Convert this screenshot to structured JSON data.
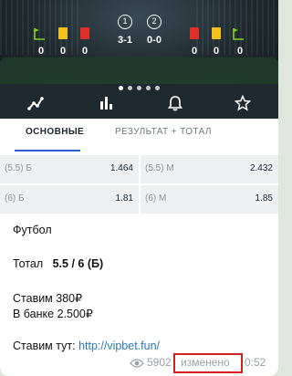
{
  "scoreboard": {
    "home": {
      "corners": "0",
      "yellow_cards": "0",
      "red_cards": "0"
    },
    "away": {
      "red_cards": "0",
      "yellow_cards": "0",
      "corners": "0"
    },
    "period1": {
      "label": "1",
      "score": "3-1"
    },
    "period2": {
      "label": "2",
      "score": "0-0"
    }
  },
  "carousel": {
    "total": 5,
    "active_index": 0
  },
  "nav_icons": [
    "trend-icon",
    "bar-chart-icon",
    "bell-icon",
    "star-icon"
  ],
  "tabs": [
    {
      "label": "ОСНОВНЫЕ",
      "active": true
    },
    {
      "label": "РЕЗУЛЬТАТ + ТОТАЛ",
      "active": false
    }
  ],
  "odds": [
    {
      "label": "(5.5) Б",
      "value": "1.464"
    },
    {
      "label": "(5.5) М",
      "value": "2.432"
    },
    {
      "label": "(6) Б",
      "value": "1.81"
    },
    {
      "label": "(6) М",
      "value": "1.85"
    }
  ],
  "message": {
    "sport": "Футбол",
    "total_prefix": "Тотал",
    "total_value": "5.5 / 6 (Б)",
    "stake": "Ставим 380₽",
    "bank": "В банке 2.500₽",
    "bet_prefix": "Ставим тут:",
    "link": "http://vipbet.fun/"
  },
  "footer": {
    "views": "5902",
    "edited": "изменено",
    "time": "0:52"
  },
  "colors": {
    "accent": "#2f5fd1",
    "highlight": "#d21f1f",
    "link": "#2b7ac0"
  }
}
